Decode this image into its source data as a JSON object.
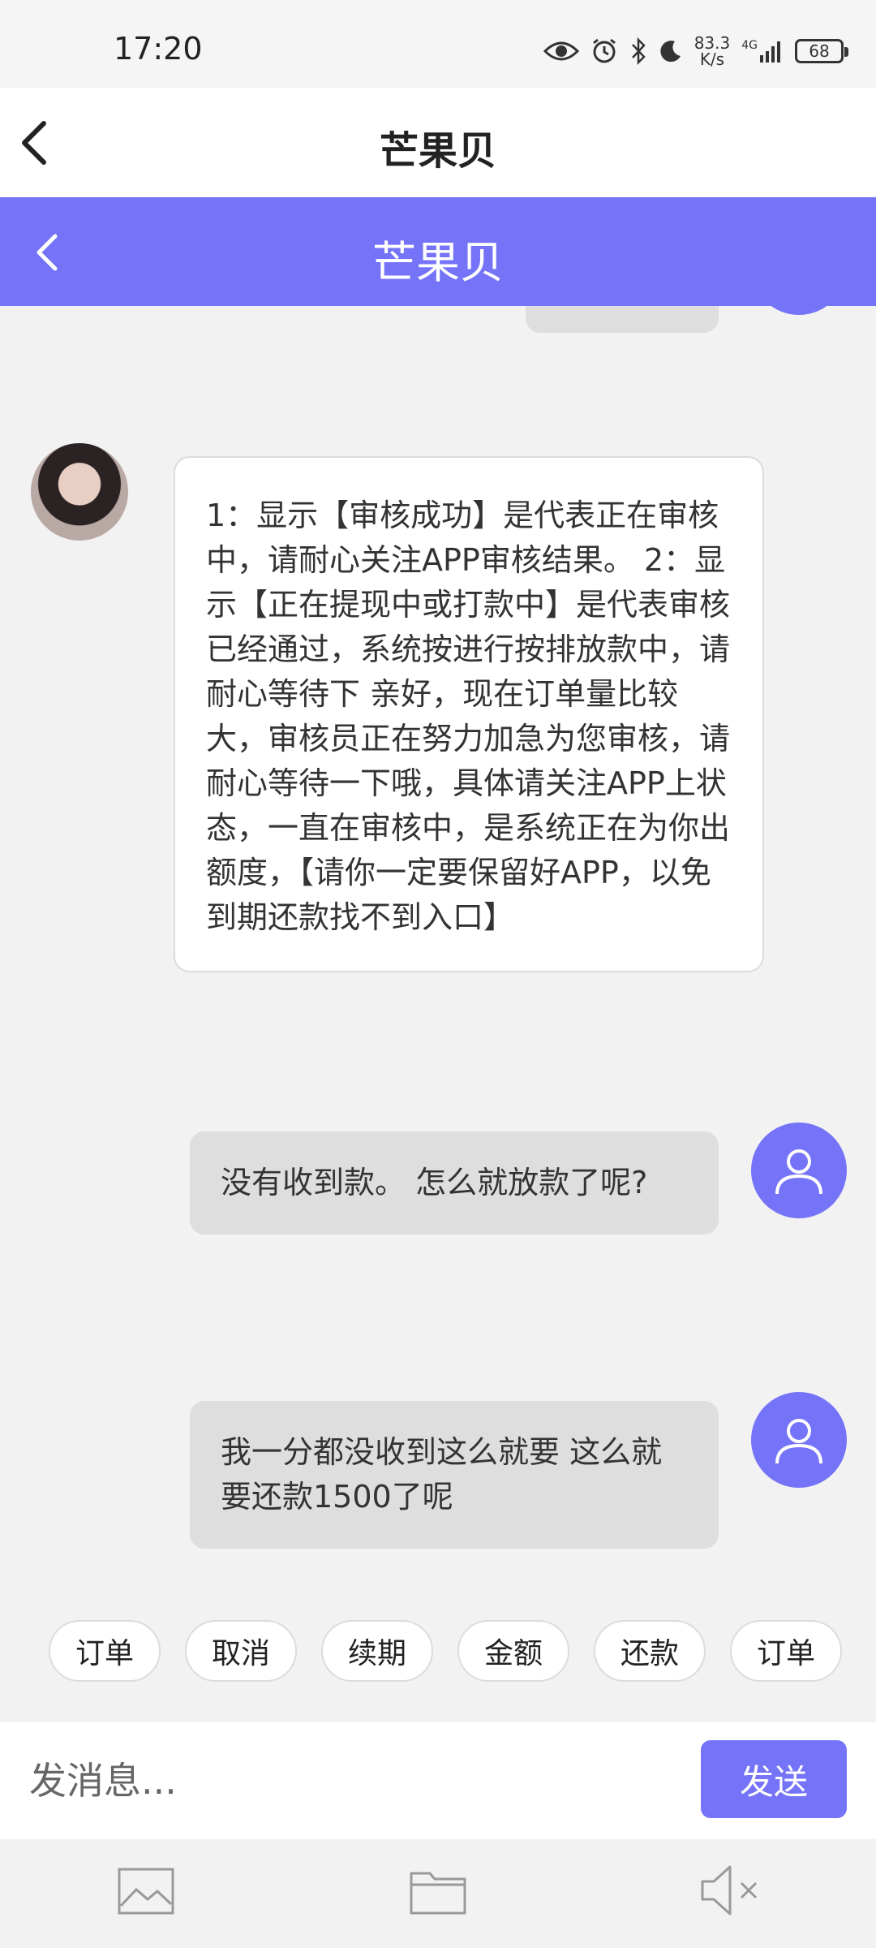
{
  "status_bar": {
    "time": "17:20",
    "net_speed_value": "83.3",
    "net_speed_unit": "K/s",
    "network": "4G",
    "battery": "68"
  },
  "header": {
    "title": "芒果贝"
  },
  "chat_header": {
    "title": "芒果贝"
  },
  "messages": [
    {
      "sender": "agent",
      "text": "1：显示【审核成功】是代表正在审核中，请耐心关注APP审核结果。 2：显示【正在提现中或打款中】是代表审核已经通过，系统按进行按排放款中，请耐心等待下 亲好，现在订单量比较大，审核员正在努力加急为您审核，请耐心等待一下哦，具体请关注APP上状态，一直在审核中，是系统正在为你出额度，【请你一定要保留好APP，以免到期还款找不到入口】"
    },
    {
      "sender": "user",
      "text": "没有收到款。 怎么就放款了呢?"
    },
    {
      "sender": "user",
      "text": "我一分都没收到这么就要 这么就要还款1500了呢"
    }
  ],
  "quick_replies": [
    "订单",
    "取消",
    "续期",
    "金额",
    "还款",
    "订单"
  ],
  "input": {
    "placeholder": "发消息...",
    "value": ""
  },
  "send_label": "发送",
  "toolbar_icons": [
    "image-icon",
    "folder-icon",
    "mute-icon"
  ],
  "colors": {
    "accent": "#7573f7",
    "bubble_user": "#dedede",
    "bubble_agent": "#ffffff"
  }
}
